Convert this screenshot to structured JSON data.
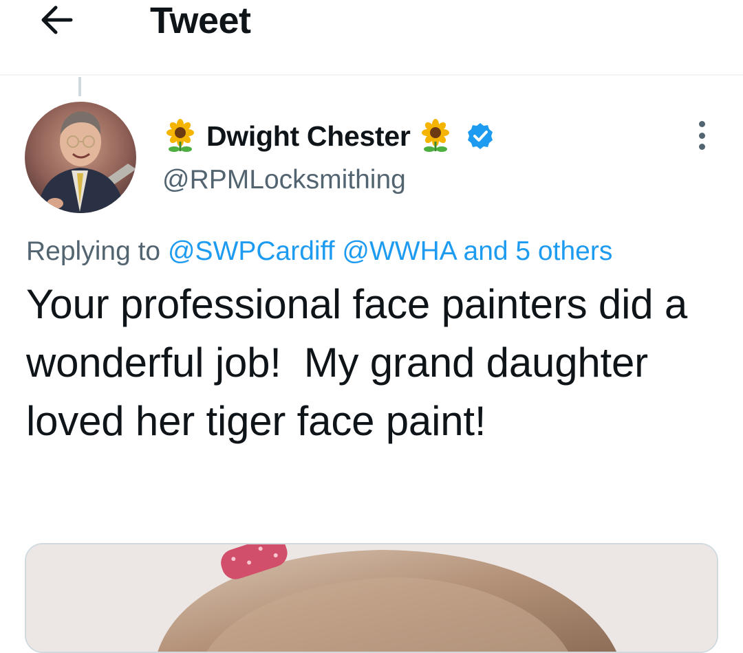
{
  "header": {
    "back_icon": "arrow-left-icon",
    "title": "Tweet"
  },
  "tweet": {
    "author": {
      "display_name": "Dwight Chester",
      "name_emoji": "sunflower-icon",
      "verified_icon": "verified-badge-icon",
      "handle": "@RPMLocksmithing"
    },
    "more_icon": "more-vertical-icon",
    "replying_to": {
      "prefix": "Replying to",
      "mention_1": "@SWPCardiff",
      "mention_2": "@WWHA",
      "others": "and 5 others"
    },
    "text": "Your professional face painters did a wonderful job!  My grand daughter loved her tiger face paint!",
    "media": {
      "type": "photo"
    }
  },
  "colors": {
    "accent": "#1d9bf0",
    "text_primary": "#0f1419",
    "text_secondary": "#536471",
    "divider": "#eff3f4"
  }
}
